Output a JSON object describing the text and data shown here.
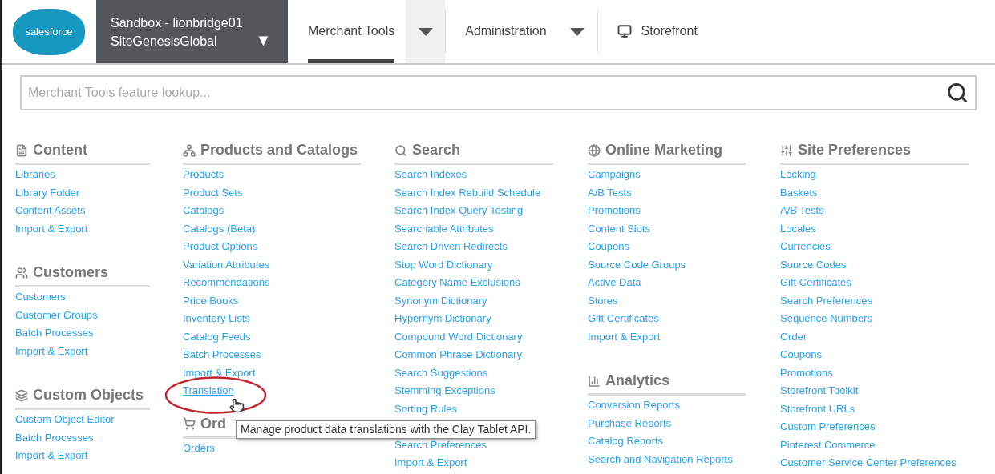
{
  "header": {
    "logo": "salesforce",
    "site": {
      "line1": "Sandbox - lionbridge01",
      "line2": "SiteGenesisGlobal",
      "caret": "▼"
    },
    "tabs": [
      {
        "label": "Merchant Tools",
        "selected": true,
        "dropdown": true
      },
      {
        "label": "Administration",
        "selected": false,
        "dropdown": true
      },
      {
        "label": "Storefront",
        "selected": false,
        "dropdown": false
      }
    ]
  },
  "search": {
    "placeholder": "Merchant Tools feature lookup..."
  },
  "columns": [
    [
      {
        "title": "Content",
        "items": [
          {
            "label": "Libraries",
            "hovered": false
          },
          {
            "label": "Library Folder",
            "hovered": false
          },
          {
            "label": "Content Assets",
            "hovered": false
          },
          {
            "label": "Import & Export",
            "hovered": false
          }
        ]
      },
      {
        "title": "Customers",
        "items": [
          {
            "label": "Customers",
            "hovered": false
          },
          {
            "label": "Customer Groups",
            "hovered": false
          },
          {
            "label": "Batch Processes",
            "hovered": false
          },
          {
            "label": "Import & Export",
            "hovered": false
          }
        ]
      },
      {
        "title": "Custom Objects",
        "items": [
          {
            "label": "Custom Object Editor",
            "hovered": false
          },
          {
            "label": "Batch Processes",
            "hovered": false
          },
          {
            "label": "Import & Export",
            "hovered": false
          }
        ]
      }
    ],
    [
      {
        "title": "Products and Catalogs",
        "items": [
          {
            "label": "Products",
            "hovered": false
          },
          {
            "label": "Product Sets",
            "hovered": false
          },
          {
            "label": "Catalogs",
            "hovered": false
          },
          {
            "label": "Catalogs (Beta)",
            "hovered": false
          },
          {
            "label": "Product Options",
            "hovered": false
          },
          {
            "label": "Variation Attributes",
            "hovered": false
          },
          {
            "label": "Recommendations",
            "hovered": false
          },
          {
            "label": "Price Books",
            "hovered": false
          },
          {
            "label": "Inventory Lists",
            "hovered": false
          },
          {
            "label": "Catalog Feeds",
            "hovered": false
          },
          {
            "label": "Batch Processes",
            "hovered": false
          },
          {
            "label": "Import & Export",
            "hovered": false
          },
          {
            "label": "Translation",
            "hovered": true
          }
        ]
      },
      {
        "title": "Ord",
        "items": [
          {
            "label": "Orders",
            "hovered": false
          }
        ]
      }
    ],
    [
      {
        "title": "Search",
        "items": [
          {
            "label": "Search Indexes",
            "hovered": false
          },
          {
            "label": "Search Index Rebuild Schedule",
            "hovered": false
          },
          {
            "label": "Search Index Query Testing",
            "hovered": false
          },
          {
            "label": "Searchable Attributes",
            "hovered": false
          },
          {
            "label": "Search Driven Redirects",
            "hovered": false
          },
          {
            "label": "Stop Word Dictionary",
            "hovered": false
          },
          {
            "label": "Category Name Exclusions",
            "hovered": false
          },
          {
            "label": "Synonym Dictionary",
            "hovered": false
          },
          {
            "label": "Hypernym Dictionary",
            "hovered": false
          },
          {
            "label": "Compound Word Dictionary",
            "hovered": false
          },
          {
            "label": "Common Phrase Dictionary",
            "hovered": false
          },
          {
            "label": "Search Suggestions",
            "hovered": false
          },
          {
            "label": "Stemming Exceptions",
            "hovered": false
          },
          {
            "label": "Sorting Rules",
            "hovered": false
          },
          {
            "label": "Search Preferences",
            "hovered": false
          },
          {
            "label": "Import & Export",
            "hovered": false
          }
        ]
      }
    ],
    [
      {
        "title": "Online Marketing",
        "items": [
          {
            "label": "Campaigns",
            "hovered": false
          },
          {
            "label": "A/B Tests",
            "hovered": false
          },
          {
            "label": "Promotions",
            "hovered": false
          },
          {
            "label": "Content Slots",
            "hovered": false
          },
          {
            "label": "Coupons",
            "hovered": false
          },
          {
            "label": "Source Code Groups",
            "hovered": false
          },
          {
            "label": "Active Data",
            "hovered": false
          },
          {
            "label": "Stores",
            "hovered": false
          },
          {
            "label": "Gift Certificates",
            "hovered": false
          },
          {
            "label": "Import & Export",
            "hovered": false
          }
        ]
      },
      {
        "title": "Analytics",
        "items": [
          {
            "label": "Conversion Reports",
            "hovered": false
          },
          {
            "label": "Purchase Reports",
            "hovered": false
          },
          {
            "label": "Catalog Reports",
            "hovered": false
          },
          {
            "label": "Search and Navigation Reports",
            "hovered": false
          }
        ]
      }
    ],
    [
      {
        "title": "Site Preferences",
        "items": [
          {
            "label": "Locking",
            "hovered": false
          },
          {
            "label": "Baskets",
            "hovered": false
          },
          {
            "label": "A/B Tests",
            "hovered": false
          },
          {
            "label": "Locales",
            "hovered": false
          },
          {
            "label": "Currencies",
            "hovered": false
          },
          {
            "label": "Source Codes",
            "hovered": false
          },
          {
            "label": "Gift Certificates",
            "hovered": false
          },
          {
            "label": "Search Preferences",
            "hovered": false
          },
          {
            "label": "Sequence Numbers",
            "hovered": false
          },
          {
            "label": "Order",
            "hovered": false
          },
          {
            "label": "Coupons",
            "hovered": false
          },
          {
            "label": "Promotions",
            "hovered": false
          },
          {
            "label": "Storefront Toolkit",
            "hovered": false
          },
          {
            "label": "Storefront URLs",
            "hovered": false
          },
          {
            "label": "Custom Preferences",
            "hovered": false
          },
          {
            "label": "Pinterest Commerce",
            "hovered": false
          },
          {
            "label": "Customer Service Center Preferences",
            "hovered": false
          }
        ]
      }
    ]
  ],
  "tooltip": "Manage product data translations with the Clay Tablet API."
}
